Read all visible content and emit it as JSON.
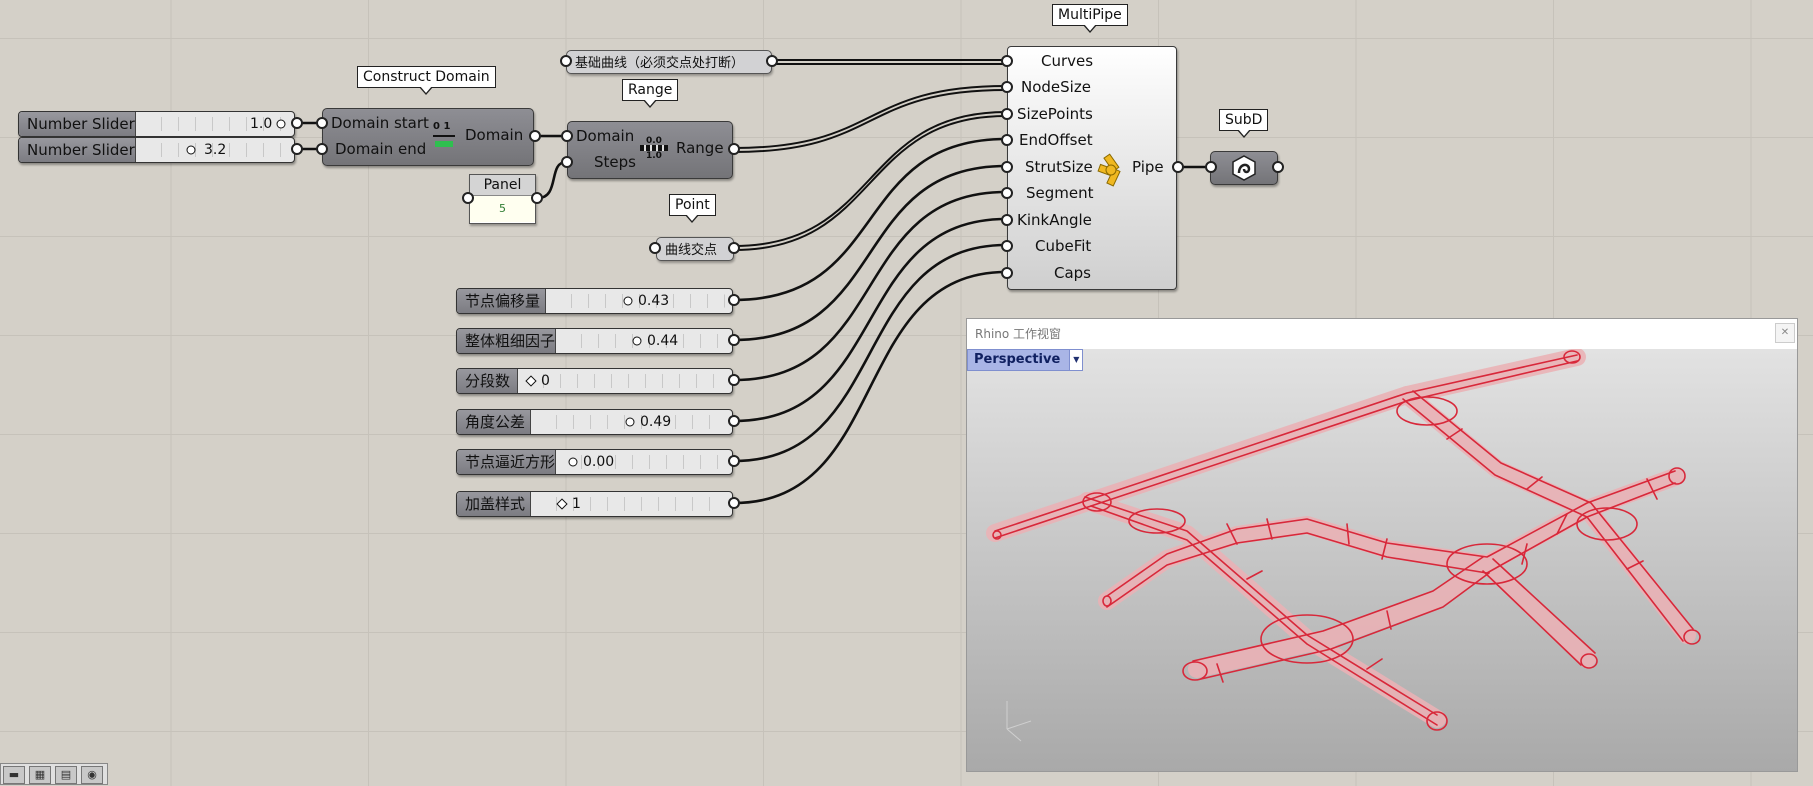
{
  "bubbles": {
    "construct_domain": "Construct Domain",
    "range": "Range",
    "point": "Point",
    "multipipe": "MultiPipe",
    "subd": "SubD"
  },
  "sliders_left": [
    {
      "name": "Number Slider",
      "value": "1.0"
    },
    {
      "name": "Number Slider",
      "value": "3.2"
    }
  ],
  "construct_domain": {
    "inputs": [
      "Domain start",
      "Domain end"
    ],
    "output": "Domain",
    "icon_text": "0 1"
  },
  "range": {
    "inputs": [
      "Domain",
      "Steps"
    ],
    "output": "Range",
    "icon_text": "0.0 1.0"
  },
  "panel": {
    "title": "Panel",
    "value": "5"
  },
  "curve_param": {
    "label": "基础曲线（必须交点处打断）"
  },
  "point_param": {
    "label": "曲线交点"
  },
  "sliders_right": [
    {
      "name": "节点偏移量",
      "value": "0.43"
    },
    {
      "name": "整体粗细因子",
      "value": "0.44"
    },
    {
      "name": "分段数",
      "value": "0"
    },
    {
      "name": "角度公差",
      "value": "0.49"
    },
    {
      "name": "节点逼近方形",
      "value": "0.00"
    },
    {
      "name": "加盖样式",
      "value": "1"
    }
  ],
  "multipipe": {
    "inputs": [
      "Curves",
      "NodeSize",
      "SizePoints",
      "EndOffset",
      "StrutSize",
      "Segment",
      "KinkAngle",
      "CubeFit",
      "Caps"
    ],
    "output": "Pipe"
  },
  "viewport": {
    "title": "Rhino 工作视窗",
    "tab": "Perspective",
    "close_icon": "close-icon"
  },
  "colors": {
    "canvas_bg": "#d4d0c8",
    "mesh_red": "#d8283a",
    "wire": "#111111"
  }
}
